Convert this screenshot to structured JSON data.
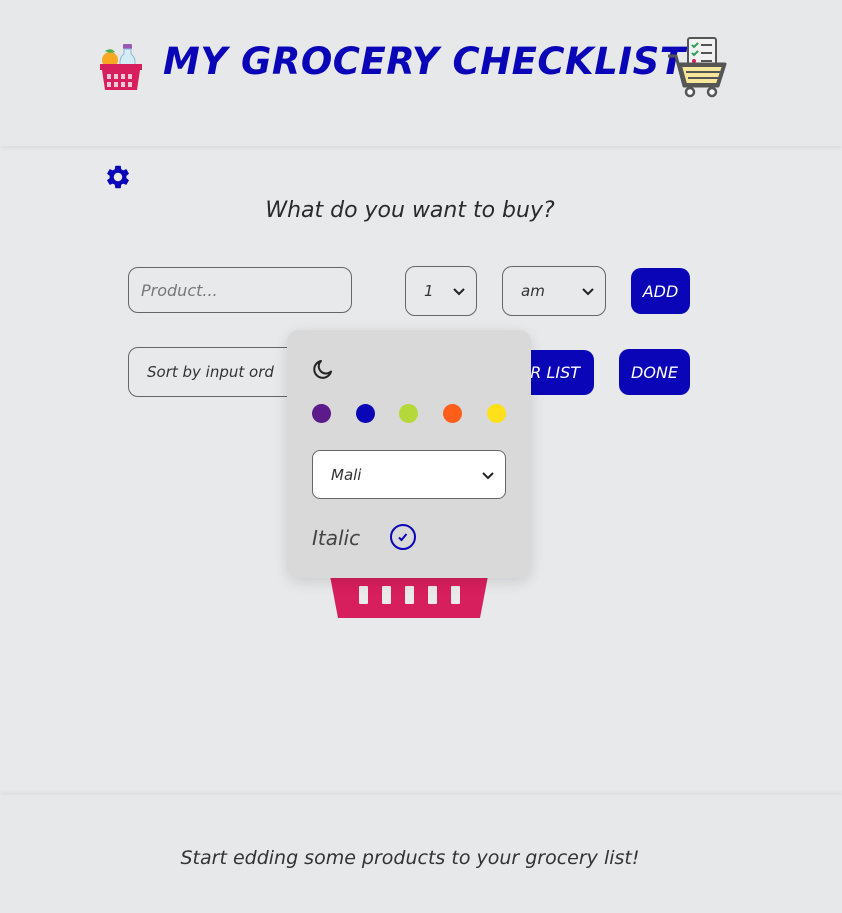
{
  "header": {
    "title": "MY GROCERY CHECKLIST",
    "left_icon": "grocery-basket-icon",
    "right_icon": "shopping-cart-checklist-icon"
  },
  "settings": {
    "icon": "gear-icon"
  },
  "main": {
    "question": "What do you want to buy?",
    "product_placeholder": "Product...",
    "product_value": "",
    "quantity_selected": "1",
    "unit_selected": "am",
    "add_label": "ADD",
    "sort_selected": "Sort by input ord",
    "clear_label": "R LIST",
    "done_label": "DONE",
    "empty_icon": "basket-icon"
  },
  "settings_panel": {
    "theme_icon": "moon-icon",
    "colors": [
      "#5c1a8a",
      "#0a06b8",
      "#b5d93a",
      "#ff5e1a",
      "#ffe01a"
    ],
    "font_selected": "Mali",
    "italic_label": "Italic",
    "italic_checked": true
  },
  "footer": {
    "message": "Start edding some products to your grocery list!"
  },
  "theme": {
    "accent": "#0a06b8",
    "basket_pink": "#d81f5e",
    "background": "#e8e9ea"
  }
}
